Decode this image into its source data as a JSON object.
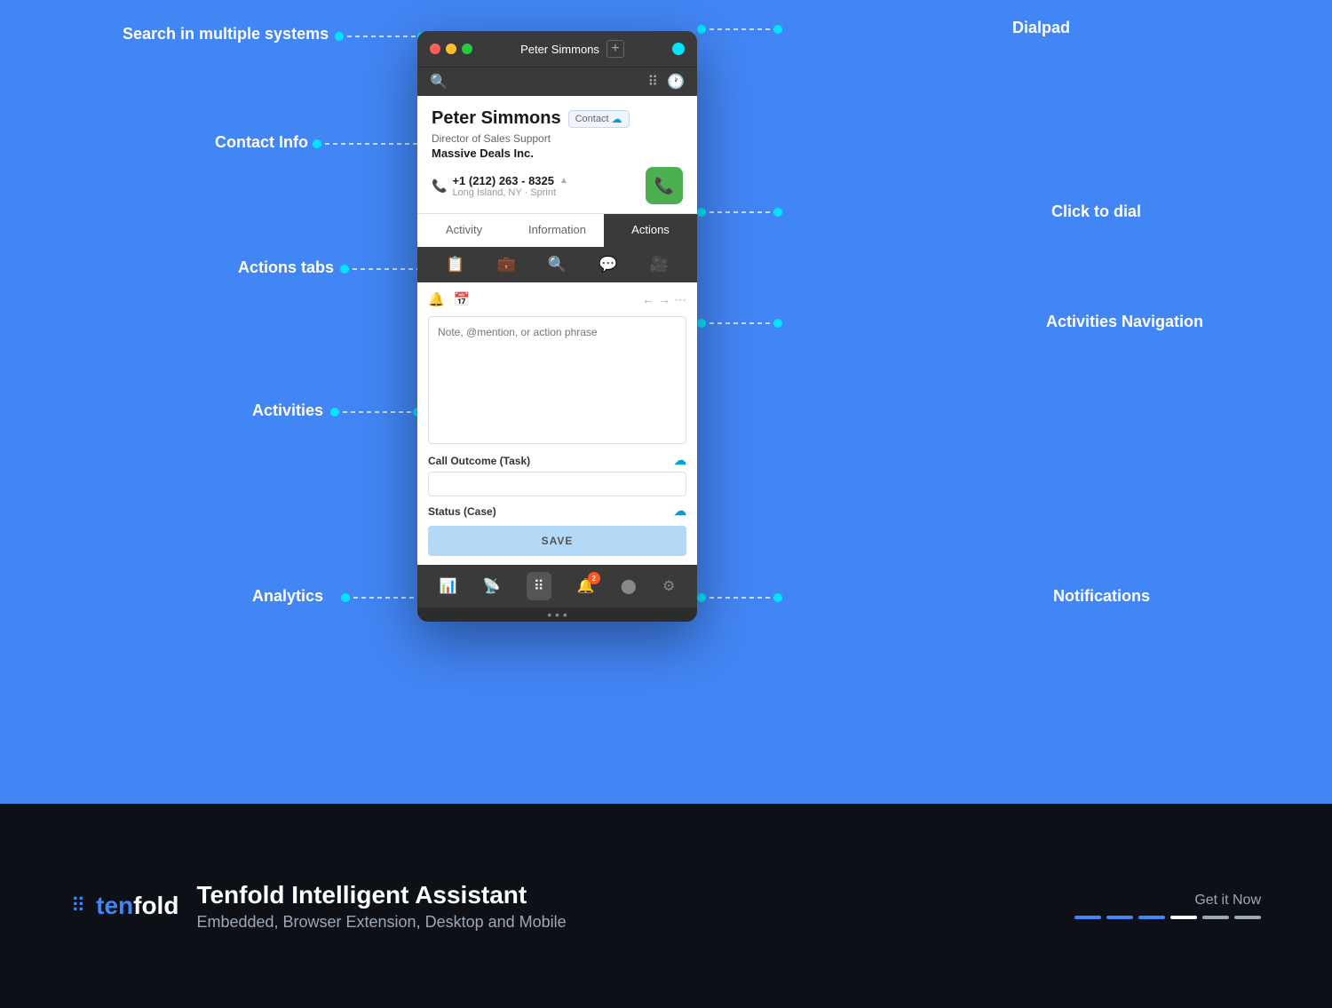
{
  "page": {
    "top_bg": "#4285f4",
    "bottom_bg": "#0d1117"
  },
  "annotations": {
    "search": "Search in multiple systems",
    "contact_info": "Contact Info",
    "actions_tabs": "Actions tabs",
    "activities": "Activities",
    "analytics": "Analytics",
    "dialpad": "Dialpad",
    "click_to_dial": "Click to dial",
    "activities_nav": "Activities Navigation",
    "notifications": "Notifications"
  },
  "phone": {
    "title_tab": "Peter Simmons",
    "add_tab": "+",
    "contact": {
      "name": "Peter Simmons",
      "badge": "Contact",
      "title": "Director of Sales Support",
      "company": "Massive Deals Inc.",
      "phone": "+1 (212) 263 - 8325",
      "location": "Long Island, NY · Sprint"
    },
    "tabs": [
      {
        "label": "Activity",
        "active": false
      },
      {
        "label": "Information",
        "active": false
      },
      {
        "label": "Actions",
        "active": true
      }
    ],
    "action_icons": [
      "clipboard",
      "briefcase",
      "binoculars",
      "comment",
      "video"
    ],
    "sub_icons": [
      "bell",
      "calendar"
    ],
    "textarea_placeholder": "Note, @mention, or action phrase",
    "call_outcome_label": "Call Outcome (Task)",
    "call_outcome_value": "",
    "status_label": "Status (Case)",
    "save_button": "SAVE",
    "bottom_nav": [
      {
        "icon": "bar-chart",
        "active": false
      },
      {
        "icon": "rss",
        "active": false
      },
      {
        "icon": "grid",
        "active": true
      },
      {
        "icon": "bell",
        "badge": "2",
        "active": false
      },
      {
        "icon": "circle",
        "active": false
      },
      {
        "icon": "gear",
        "active": false
      }
    ]
  },
  "footer": {
    "logo_symbol": "⠿",
    "logo_brand_prefix": "ten",
    "logo_brand_suffix": "fold",
    "title": "Tenfold Intelligent Assistant",
    "subtitle": "Embedded, Browser Extension, Desktop and Mobile",
    "cta_label": "Get it Now",
    "cta_dots": [
      {
        "color": "#4285f4"
      },
      {
        "color": "#4285f4"
      },
      {
        "color": "#4285f4"
      },
      {
        "color": "white"
      },
      {
        "color": "#9ba8b8"
      },
      {
        "color": "#9ba8b8"
      }
    ]
  }
}
